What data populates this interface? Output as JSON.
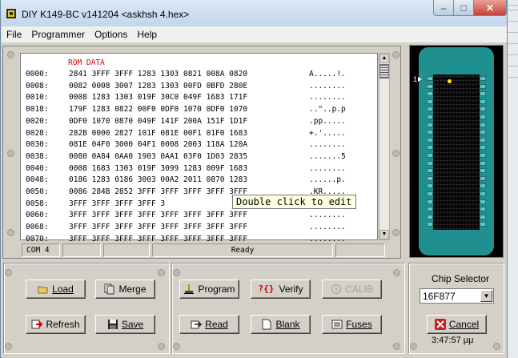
{
  "window": {
    "title": "DIY K149-BC v141204  <askhsh 4.hex>",
    "min_label": "–",
    "max_label": "□",
    "close_label": "✕"
  },
  "menu": {
    "items": [
      "File",
      "Programmer",
      "Options",
      "Help"
    ]
  },
  "hex": {
    "header": "ROM DATA",
    "rows": [
      {
        "addr": "0000:",
        "bytes": "2841 3FFF 3FFF 1283 1303 0821 008A 0820",
        "ascii": "A.....!."
      },
      {
        "addr": "0008:",
        "bytes": "0082 0008 3007 1283 1303 00FD 0BFD 280E",
        "ascii": "........"
      },
      {
        "addr": "0010:",
        "bytes": "0008 1283 1303 019F 30C0 049F 1683 171F",
        "ascii": "........"
      },
      {
        "addr": "0018:",
        "bytes": "179F 1283 0822 00F0 0DF0 1070 0DF0 1070",
        "ascii": "..\"..p.p"
      },
      {
        "addr": "0020:",
        "bytes": "0DF0 1070 0870 049F 141F 200A 151F 1D1F",
        "ascii": ".pp....."
      },
      {
        "addr": "0028:",
        "bytes": "282B 0000 2827 101F 081E 00F1 01F0 1683",
        "ascii": "+.'....."
      },
      {
        "addr": "0030:",
        "bytes": "081E 04F0 3000 04F1 0008 2003 118A 120A",
        "ascii": "........"
      },
      {
        "addr": "0038:",
        "bytes": "0080 0A84 0AA0 1903 0AA1 03F0 1D03 2835",
        "ascii": ".......5"
      },
      {
        "addr": "0040:",
        "bytes": "0008 1683 1303 019F 3099 1283 009F 1683",
        "ascii": "........"
      },
      {
        "addr": "0048:",
        "bytes": "0186 1283 0186 3003 00A2 2011 0870 1283",
        "ascii": "......p."
      },
      {
        "addr": "0050:",
        "bytes": "0086 284B 2852 3FFF 3FFF 3FFF 3FFF 3FFF",
        "ascii": ".KR....."
      },
      {
        "addr": "0058:",
        "bytes": "3FFF 3FFF 3FFF 3FFF 3",
        "ascii": "........"
      },
      {
        "addr": "0060:",
        "bytes": "3FFF 3FFF 3FFF 3FFF 3FFF 3FFF 3FFF 3FFF",
        "ascii": "........"
      },
      {
        "addr": "0068:",
        "bytes": "3FFF 3FFF 3FFF 3FFF 3FFF 3FFF 3FFF 3FFF",
        "ascii": "........"
      },
      {
        "addr": "0070:",
        "bytes": "3FFF 3FFF 3FFF 3FFF 3FFF 3FFF 3FFF 3FFF",
        "ascii": "........"
      }
    ],
    "tooltip": "Double click to edit"
  },
  "status": {
    "port": "COM 4",
    "message": "Ready"
  },
  "chip": {
    "pin1_label": "1",
    "selector_label": "Chip Selector",
    "selected": "16F877"
  },
  "buttons": {
    "load": "Load",
    "merge": "Merge",
    "refresh": "Refresh",
    "save": "Save",
    "program": "Program",
    "verify": "Verify",
    "calib": "CALIB",
    "read": "Read",
    "blank": "Blank",
    "fuses": "Fuses",
    "cancel": "Cancel"
  },
  "clock": "3:47:57 μμ",
  "colors": {
    "rom_header": "#e00000",
    "chip_body": "#1f8f8f",
    "pin1_dot": "#ffe900"
  }
}
